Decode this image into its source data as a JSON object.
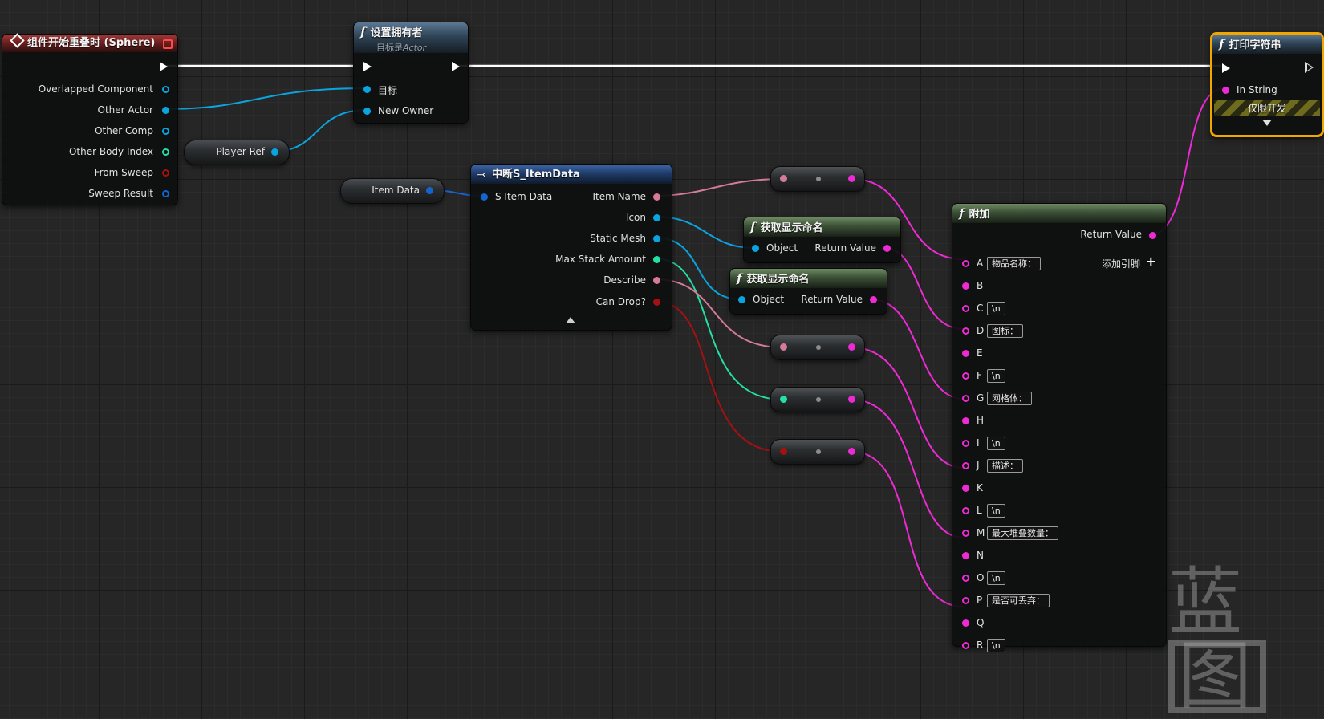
{
  "colors": {
    "exec": "#ffffff",
    "object": "#0aa4e0",
    "string": "#ee2ad4",
    "name": "#d57a99",
    "int": "#22e0a6",
    "bool": "#a51010",
    "struct": "#1565d0",
    "vector": "#2bd9ba",
    "selected_outline": "#f2a600"
  },
  "event_node": {
    "title": "组件开始重叠时 (Sphere)",
    "icon": "event-diamond-icon",
    "outputs": [
      "Overlapped Component",
      "Other Actor",
      "Other Comp",
      "Other Body Index",
      "From Sweep",
      "Sweep Result"
    ]
  },
  "set_owner_node": {
    "title": "设置拥有者",
    "subtitle_prefix": "目标是",
    "subtitle_target": "Actor",
    "inputs": [
      "目标",
      "New Owner"
    ]
  },
  "player_ref": {
    "label": "Player Ref"
  },
  "item_data": {
    "label": "Item Data"
  },
  "break_node": {
    "title": "中断S_ItemData",
    "input": "S Item Data",
    "outputs": [
      "Item Name",
      "Icon",
      "Static Mesh",
      "Max Stack Amount",
      "Describe",
      "Can Drop?"
    ]
  },
  "display_name_1": {
    "title": "获取显示命名",
    "input": "Object",
    "output": "Return Value"
  },
  "display_name_2": {
    "title": "获取显示命名",
    "input": "Object",
    "output": "Return Value"
  },
  "append_node": {
    "title": "附加",
    "output": "Return Value",
    "add_pin": "添加引脚",
    "pins": [
      {
        "name": "A",
        "value": "物品名称："
      },
      {
        "name": "B",
        "value": ""
      },
      {
        "name": "C",
        "value": "\\n"
      },
      {
        "name": "D",
        "value": "图标："
      },
      {
        "name": "E",
        "value": ""
      },
      {
        "name": "F",
        "value": "\\n"
      },
      {
        "name": "G",
        "value": "网格体："
      },
      {
        "name": "H",
        "value": ""
      },
      {
        "name": "I",
        "value": "\\n"
      },
      {
        "name": "J",
        "value": "描述："
      },
      {
        "name": "K",
        "value": ""
      },
      {
        "name": "L",
        "value": "\\n"
      },
      {
        "name": "M",
        "value": "最大堆叠数量："
      },
      {
        "name": "N",
        "value": ""
      },
      {
        "name": "O",
        "value": "\\n"
      },
      {
        "name": "P",
        "value": "是否可丢弃："
      },
      {
        "name": "Q",
        "value": ""
      },
      {
        "name": "R",
        "value": "\\n"
      }
    ]
  },
  "print_node": {
    "title": "打印字符串",
    "input": "In String",
    "dev_only": "仅限开发"
  },
  "watermark": {
    "text1": "蓝",
    "text2": "图"
  }
}
